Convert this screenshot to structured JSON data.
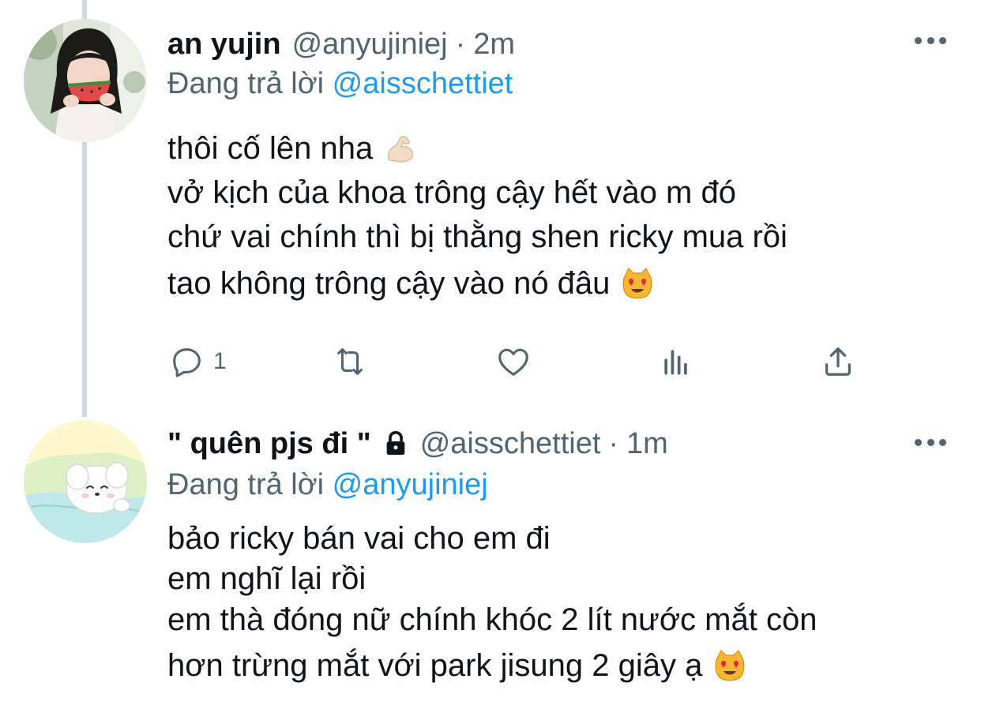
{
  "tweets": [
    {
      "display_name": "an yujin",
      "handle": "@anyujiniej",
      "separator": "·",
      "time": "2m",
      "reply_prefix": "Đang trả lời",
      "reply_to": "@aisschettiet",
      "lines": [
        "thôi cố lên nha",
        "vở kịch của khoa trông cậy hết vào m đó",
        "chứ vai chính thì bị thằng shen ricky mua rồi",
        "tao không trông cậy vào nó đâu"
      ],
      "actions": {
        "reply_count": "1"
      },
      "icons": [
        "reply-icon",
        "retweet-icon",
        "like-icon",
        "analytics-icon",
        "share-icon",
        "more-icon",
        "flexed-biceps-emoji",
        "heart-eyes-cat-emoji"
      ]
    },
    {
      "display_name": "\" quên pjs đi \"",
      "locked": true,
      "handle": "@aisschettiet",
      "separator": "·",
      "time": "1m",
      "reply_prefix": "Đang trả lời",
      "reply_to": "@anyujiniej",
      "lines": [
        "bảo ricky bán vai cho em đi",
        "em nghĩ lại rồi",
        "em thà đóng nữ chính khóc 2 lít nước mắt còn",
        "hơn trừng mắt với park jisung 2 giây ạ"
      ],
      "icons": [
        "lock-icon",
        "more-icon",
        "heart-eyes-cat-emoji"
      ]
    }
  ],
  "colors": {
    "text": "#0f1419",
    "secondary": "#536471",
    "link": "#1d9bf0",
    "thread_line": "#cfd9de"
  }
}
